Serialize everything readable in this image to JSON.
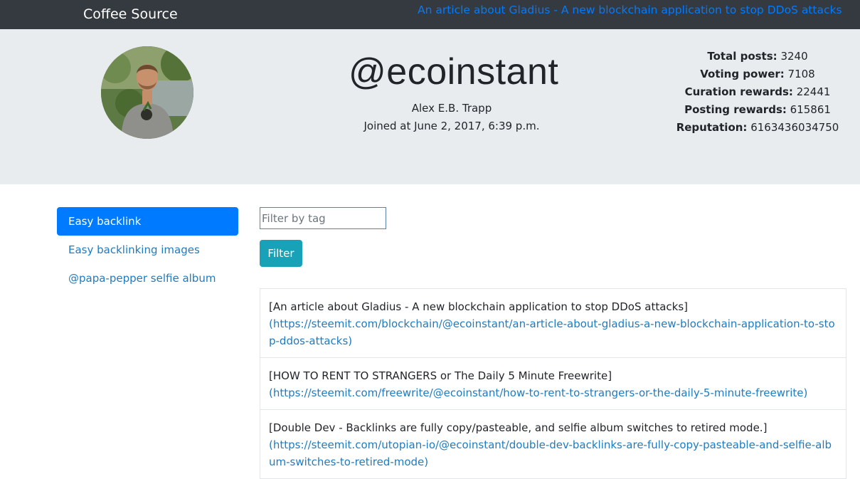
{
  "navbar": {
    "brand": "Coffee Source",
    "article_link": "An article about Gladius - A new blockchain application to stop DDoS attacks"
  },
  "profile": {
    "username": "@ecoinstant",
    "name": "Alex E.B. Trapp",
    "joined": "Joined at June 2, 2017, 6:39 p.m.",
    "stats": {
      "total_posts_label": "Total posts:",
      "total_posts_value": "3240",
      "voting_power_label": "Voting power:",
      "voting_power_value": "7108",
      "curation_label": "Curation rewards:",
      "curation_value": "22441",
      "posting_label": "Posting rewards:",
      "posting_value": "615861",
      "reputation_label": "Reputation:",
      "reputation_value": "6163436034750"
    }
  },
  "sidebar": {
    "items": [
      {
        "label": "Easy backlink"
      },
      {
        "label": "Easy backlinking images"
      },
      {
        "label": "@papa-pepper selfie album"
      }
    ]
  },
  "filter": {
    "placeholder": "Filter by tag",
    "button_label": "Filter"
  },
  "posts": [
    {
      "title": "[An article about Gladius - A new blockchain application to stop DDoS attacks]",
      "url": "(https://steemit.com/blockchain/@ecoinstant/an-article-about-gladius-a-new-blockchain-application-to-stop-ddos-attacks)"
    },
    {
      "title": "[HOW TO RENT TO STRANGERS or The Daily 5 Minute Freewrite]",
      "url": "(https://steemit.com/freewrite/@ecoinstant/how-to-rent-to-strangers-or-the-daily-5-minute-freewrite)"
    },
    {
      "title": "[Double Dev - Backlinks are fully copy/pasteable, and selfie album switches to retired mode.]",
      "url": "(https://steemit.com/utopian-io/@ecoinstant/double-dev-backlinks-are-fully-copy-pasteable-and-selfie-album-switches-to-retired-mode)"
    }
  ]
}
